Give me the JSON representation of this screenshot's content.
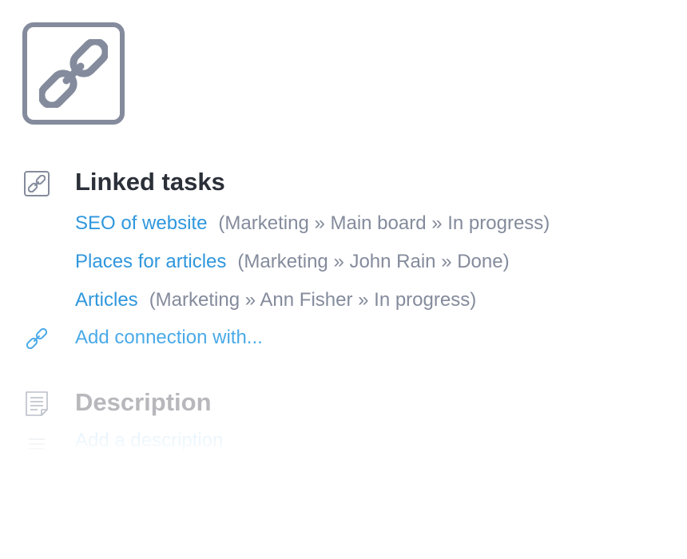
{
  "linked_tasks": {
    "heading": "Linked tasks",
    "items": [
      {
        "title": "SEO of website",
        "path": "(Marketing » Main board » In progress)"
      },
      {
        "title": "Places for articles",
        "path": "(Marketing » John Rain » Done)"
      },
      {
        "title": "Articles",
        "path": "(Marketing » Ann Fisher » In progress)"
      }
    ],
    "add_connection_label": "Add connection with..."
  },
  "description": {
    "heading": "Description",
    "placeholder": "Add a description"
  },
  "icons": {
    "hero": "link-icon",
    "linked_tasks": "link-square-icon",
    "add_connection": "link-icon",
    "description": "document-icon",
    "description_add": "lines-icon"
  },
  "colors": {
    "link": "#2f97dd",
    "meta": "#848b9c",
    "heading": "#2b2f38",
    "icon": "#848b9c"
  }
}
